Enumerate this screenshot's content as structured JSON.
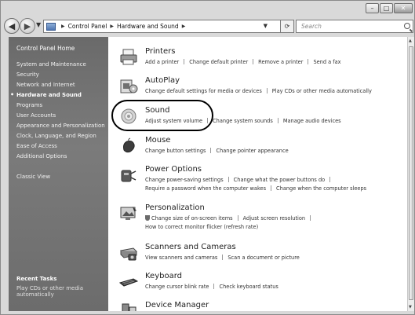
{
  "address": {
    "crumbs": [
      "Control Panel",
      "Hardware and Sound"
    ]
  },
  "search": {
    "placeholder": "Search"
  },
  "sidebar": {
    "home": "Control Panel Home",
    "items": [
      "System and Maintenance",
      "Security",
      "Network and Internet",
      "Hardware and Sound",
      "Programs",
      "User Accounts",
      "Appearance and Personalization",
      "Clock, Language, and Region",
      "Ease of Access",
      "Additional Options"
    ],
    "active_index": 3,
    "classic": "Classic View",
    "recent_title": "Recent Tasks",
    "recent_item": "Play CDs or other media automatically"
  },
  "categories": [
    {
      "title": "Printers",
      "icon": "printer-icon",
      "lines": [
        [
          "Add a printer",
          "Change default printer",
          "Remove a printer",
          "Send a fax"
        ]
      ]
    },
    {
      "title": "AutoPlay",
      "icon": "autoplay-icon",
      "lines": [
        [
          "Change default settings for media or devices",
          "Play CDs or other media automatically"
        ]
      ]
    },
    {
      "title": "Sound",
      "icon": "speaker-icon",
      "lines": [
        [
          "Adjust system volume",
          "Change system sounds",
          "Manage audio devices"
        ]
      ]
    },
    {
      "title": "Mouse",
      "icon": "mouse-icon",
      "lines": [
        [
          "Change button settings",
          "Change pointer appearance"
        ]
      ]
    },
    {
      "title": "Power Options",
      "icon": "power-icon",
      "lines": [
        [
          "Change power-saving settings",
          "Change what the power buttons do"
        ],
        [
          "Require a password when the computer wakes",
          "Change when the computer sleeps"
        ]
      ]
    },
    {
      "title": "Personalization",
      "icon": "personalization-icon",
      "lines": [
        [
          "Change size of on-screen items",
          "Adjust screen resolution"
        ],
        [
          "How to correct monitor flicker (refresh rate)"
        ]
      ]
    },
    {
      "title": "Scanners and Cameras",
      "icon": "scanner-icon",
      "lines": [
        [
          "View scanners and cameras",
          "Scan a document or picture"
        ]
      ]
    },
    {
      "title": "Keyboard",
      "icon": "keyboard-icon",
      "lines": [
        [
          "Change cursor blink rate",
          "Check keyboard status"
        ]
      ]
    },
    {
      "title": "Device Manager",
      "icon": "device-manager-icon",
      "lines": []
    }
  ]
}
